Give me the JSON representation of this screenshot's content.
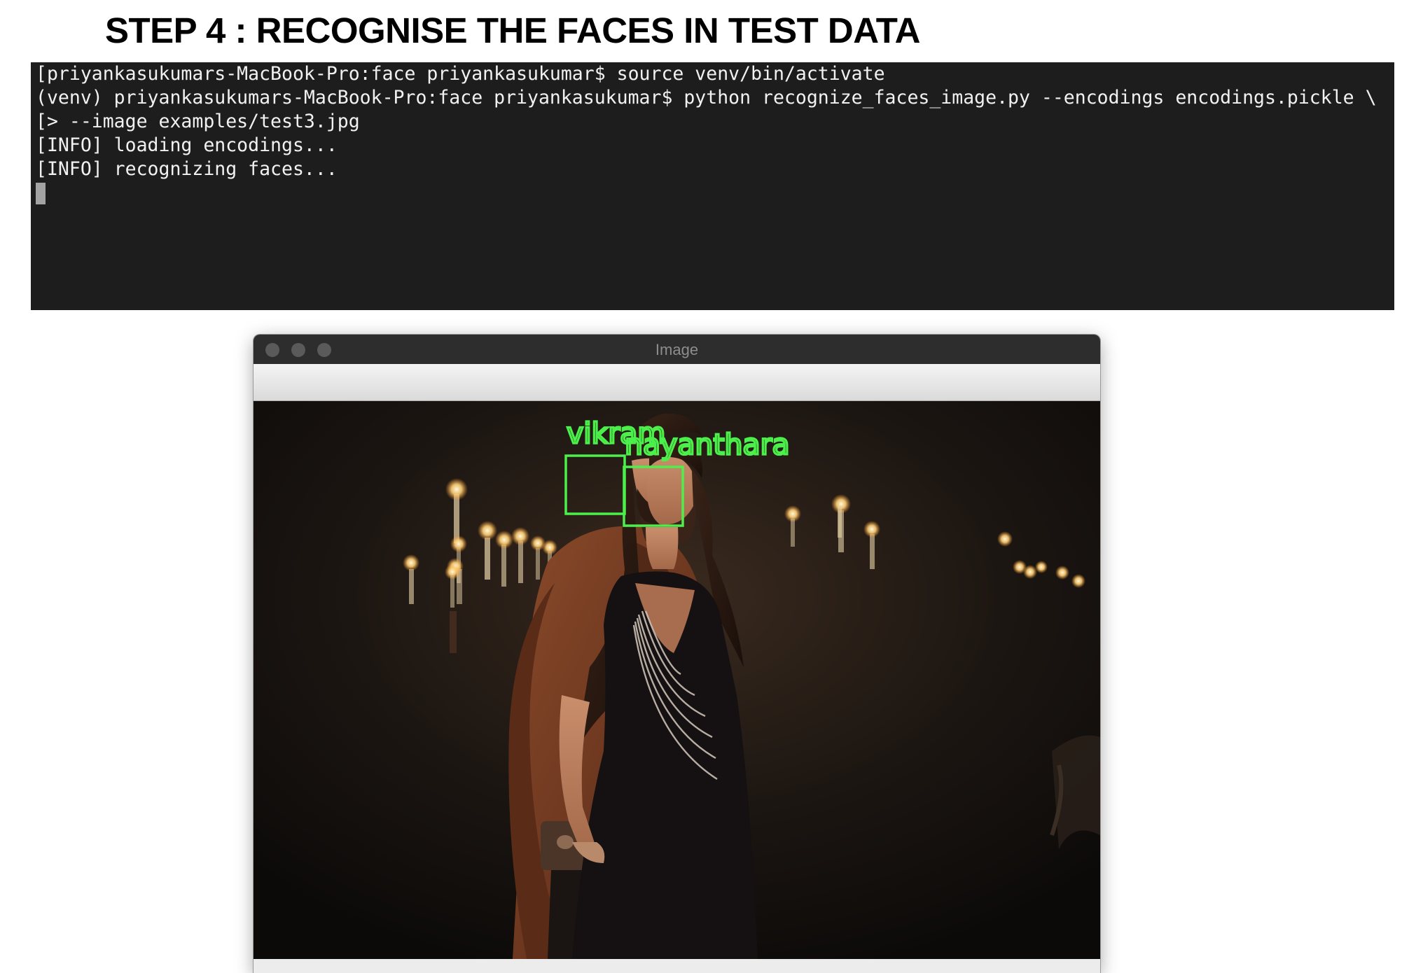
{
  "page": {
    "heading": "STEP 4 : RECOGNISE THE FACES IN TEST DATA"
  },
  "terminal": {
    "lines": [
      "[priyankasukumars-MacBook-Pro:face priyankasukumar$ source venv/bin/activate",
      "(venv) priyankasukumars-MacBook-Pro:face priyankasukumar$ python recognize_faces_image.py --encodings encodings.pickle \\",
      "[> --image examples/test3.jpg",
      "[INFO] loading encodings...",
      "[INFO] recognizing faces..."
    ]
  },
  "image_window": {
    "title": "Image",
    "faces": [
      {
        "name": "vikram"
      },
      {
        "name": "nayanthara"
      }
    ]
  },
  "colors": {
    "terminal_bg": "#1d1d1d",
    "terminal_text": "#f1f1f1",
    "detection_box": "#4cf04a"
  },
  "icons": {
    "window_controls": [
      "close-dot",
      "minimize-dot",
      "zoom-dot"
    ]
  }
}
